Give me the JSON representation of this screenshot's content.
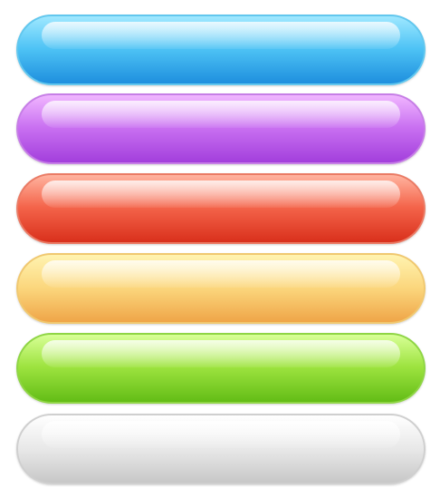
{
  "buttons": [
    {
      "id": "blue",
      "label": "",
      "color": "#4ec3f5"
    },
    {
      "id": "purple",
      "label": "",
      "color": "#c970f1"
    },
    {
      "id": "red",
      "label": "",
      "color": "#f4644a"
    },
    {
      "id": "yellow",
      "label": "",
      "color": "#fbd67c"
    },
    {
      "id": "green",
      "label": "",
      "color": "#9de33f"
    },
    {
      "id": "gray",
      "label": "",
      "color": "#e7e7e7"
    }
  ]
}
